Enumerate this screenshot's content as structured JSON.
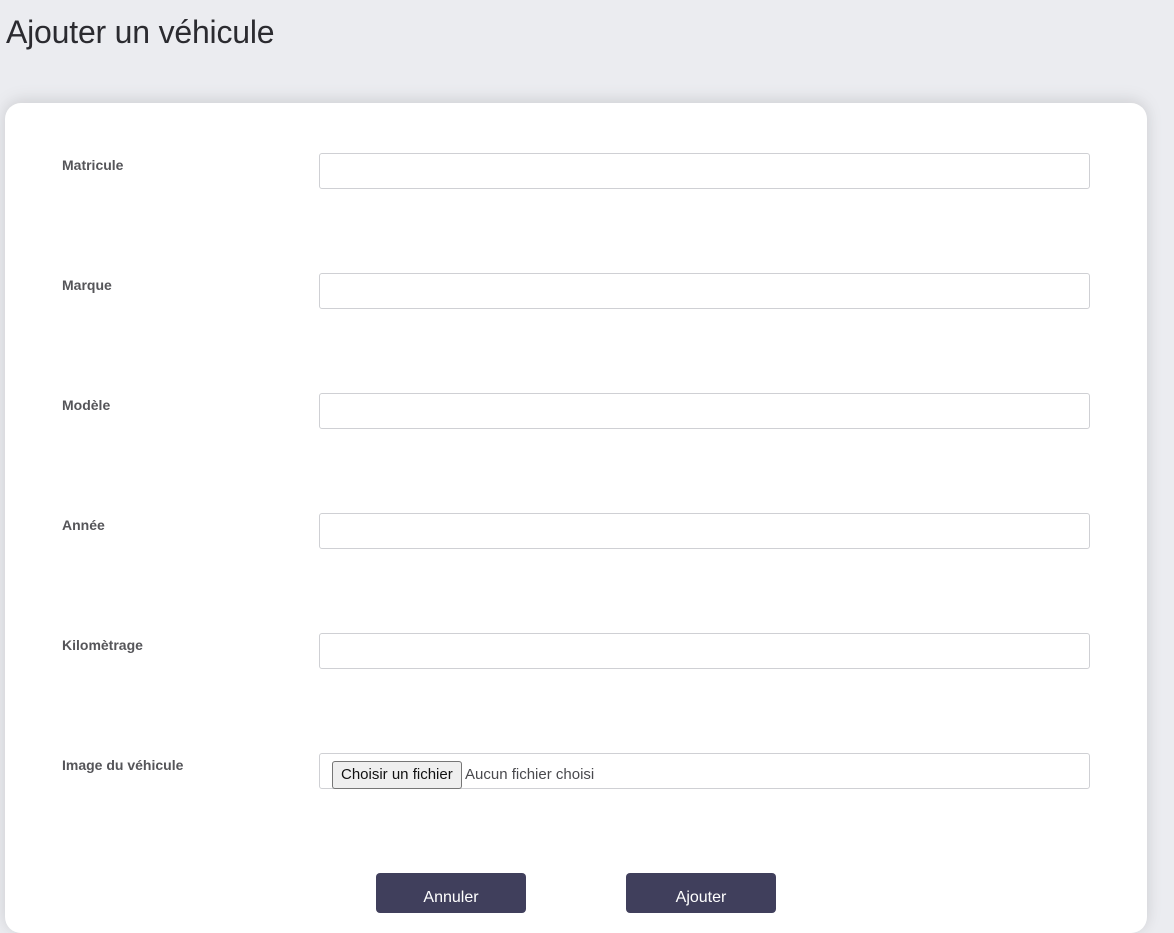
{
  "page": {
    "title": "Ajouter un véhicule"
  },
  "form": {
    "fields": [
      {
        "label": "Matricule",
        "value": "",
        "placeholder": ""
      },
      {
        "label": "Marque",
        "value": "",
        "placeholder": ""
      },
      {
        "label": "Modèle",
        "value": "",
        "placeholder": ""
      },
      {
        "label": "Année",
        "value": "",
        "placeholder": ""
      },
      {
        "label": "Kilomètrage",
        "value": "",
        "placeholder": ""
      }
    ],
    "image_field": {
      "label": "Image du véhicule",
      "button_label": "Choisir un fichier",
      "status": "Aucun fichier choisi"
    },
    "actions": {
      "cancel_label": "Annuler",
      "submit_label": "Ajouter"
    }
  },
  "colors": {
    "background": "#ebecf0",
    "card": "#ffffff",
    "button": "#403f5c",
    "button_text": "#ffffff",
    "label": "#555559"
  }
}
